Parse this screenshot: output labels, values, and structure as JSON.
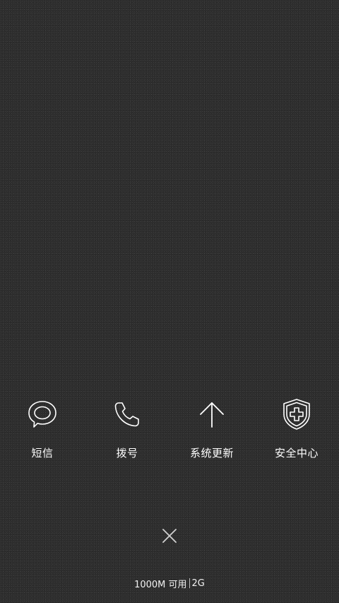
{
  "shortcuts": [
    {
      "label": "短信",
      "icon": "message-bubble-icon"
    },
    {
      "label": "拨号",
      "icon": "phone-icon"
    },
    {
      "label": "系统更新",
      "icon": "arrow-up-icon"
    },
    {
      "label": "安全中心",
      "icon": "shield-plus-icon"
    }
  ],
  "close": {
    "icon": "close-icon"
  },
  "status": {
    "memory": "1000M 可用",
    "total": "2G"
  },
  "colors": {
    "background": "#2e2e2e",
    "foreground": "#ffffff"
  }
}
